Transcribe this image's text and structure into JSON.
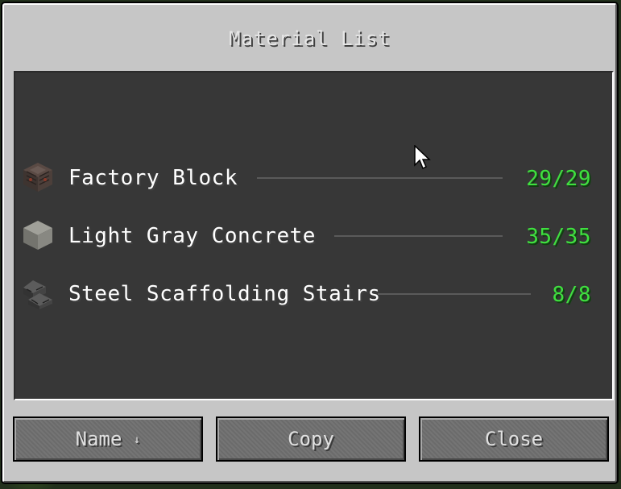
{
  "window": {
    "title": "Material List"
  },
  "materials": [
    {
      "name": "Factory Block",
      "count": "29/29",
      "icon": "factory-block-icon"
    },
    {
      "name": "Light Gray Concrete",
      "count": "35/35",
      "icon": "light-gray-concrete-icon"
    },
    {
      "name": "Steel Scaffolding Stairs",
      "count": "8/8",
      "icon": "steel-scaffolding-stairs-icon"
    }
  ],
  "buttons": {
    "sort_label": "Name",
    "sort_arrow": "↓",
    "copy_label": "Copy",
    "close_label": "Close"
  },
  "colors": {
    "count_complete": "#3fe03f",
    "list_background": "#373737",
    "window_background": "#c6c6c6"
  }
}
